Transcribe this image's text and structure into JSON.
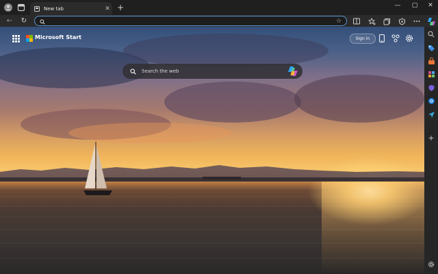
{
  "tab": {
    "title": "New tab",
    "close": "✕"
  },
  "newtab": {
    "plus": "+"
  },
  "window_controls": {
    "minimize": "—",
    "maximize": "▢",
    "close": "✕"
  },
  "nav": {
    "back": "←",
    "refresh": "↻"
  },
  "address": {
    "value": "",
    "placeholder": ""
  },
  "header": {
    "brand": "Microsoft Start",
    "signin": "Sign in"
  },
  "search": {
    "placeholder": "Search the web"
  },
  "colors": {
    "ms_red": "#f25022",
    "ms_green": "#7fba00",
    "ms_blue": "#00a4ef",
    "ms_yellow": "#ffb900",
    "focus_blue": "#5a97d4"
  },
  "sidebar": {
    "items": [
      "search-icon",
      "tag-icon",
      "shopping-bag-icon",
      "office-icon",
      "shield-icon",
      "outlook-icon",
      "send-icon",
      "plus-icon",
      "gear-icon"
    ],
    "add": "+"
  }
}
